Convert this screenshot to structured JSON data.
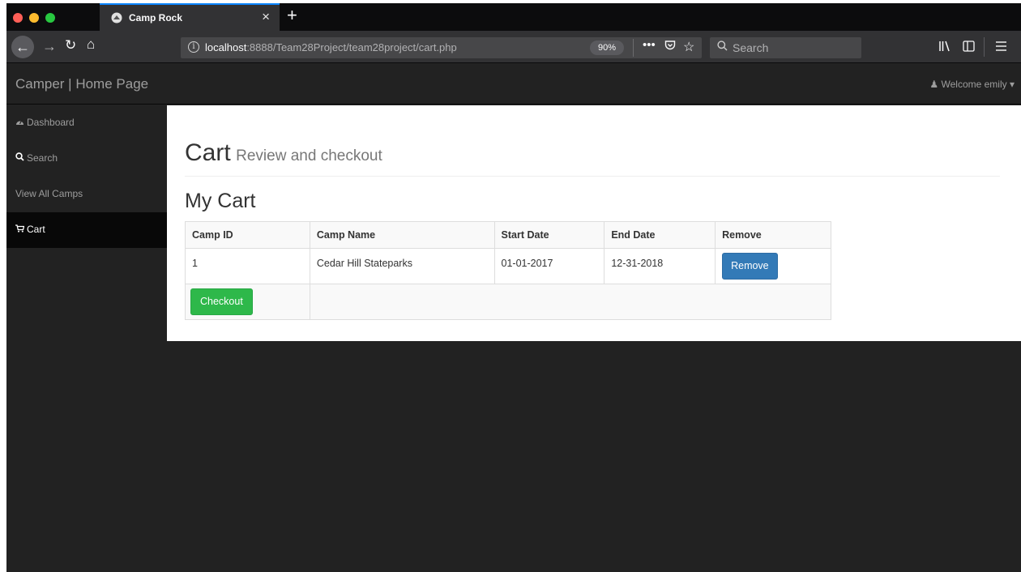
{
  "browser": {
    "tab_title": "Camp Rock",
    "url_host": "localhost",
    "url_path": ":8888/Team28Project/team28project/cart.php",
    "zoom": "90%",
    "search_placeholder": "Search",
    "colors": {
      "close": "#ff5f57",
      "minimize": "#febc2e",
      "maximize": "#28c840",
      "accent": "#0a84ff"
    }
  },
  "app": {
    "brand": "Camper | Home Page",
    "welcome": "Welcome emily"
  },
  "sidebar": {
    "items": [
      {
        "label": "Dashboard",
        "icon": "dashboard-icon"
      },
      {
        "label": "Search",
        "icon": "search-icon"
      },
      {
        "label": "View All Camps",
        "icon": ""
      },
      {
        "label": "Cart",
        "icon": "cart-icon"
      }
    ]
  },
  "main": {
    "title": "Cart",
    "subtitle": "Review and checkout",
    "section_title": "My Cart",
    "table": {
      "headers": [
        "Camp ID",
        "Camp Name",
        "Start Date",
        "End Date",
        "Remove"
      ],
      "rows": [
        {
          "camp_id": "1",
          "camp_name": "Cedar Hill Stateparks",
          "start_date": "01-01-2017",
          "end_date": "12-31-2018",
          "remove_label": "Remove"
        }
      ]
    },
    "checkout_label": "Checkout"
  }
}
